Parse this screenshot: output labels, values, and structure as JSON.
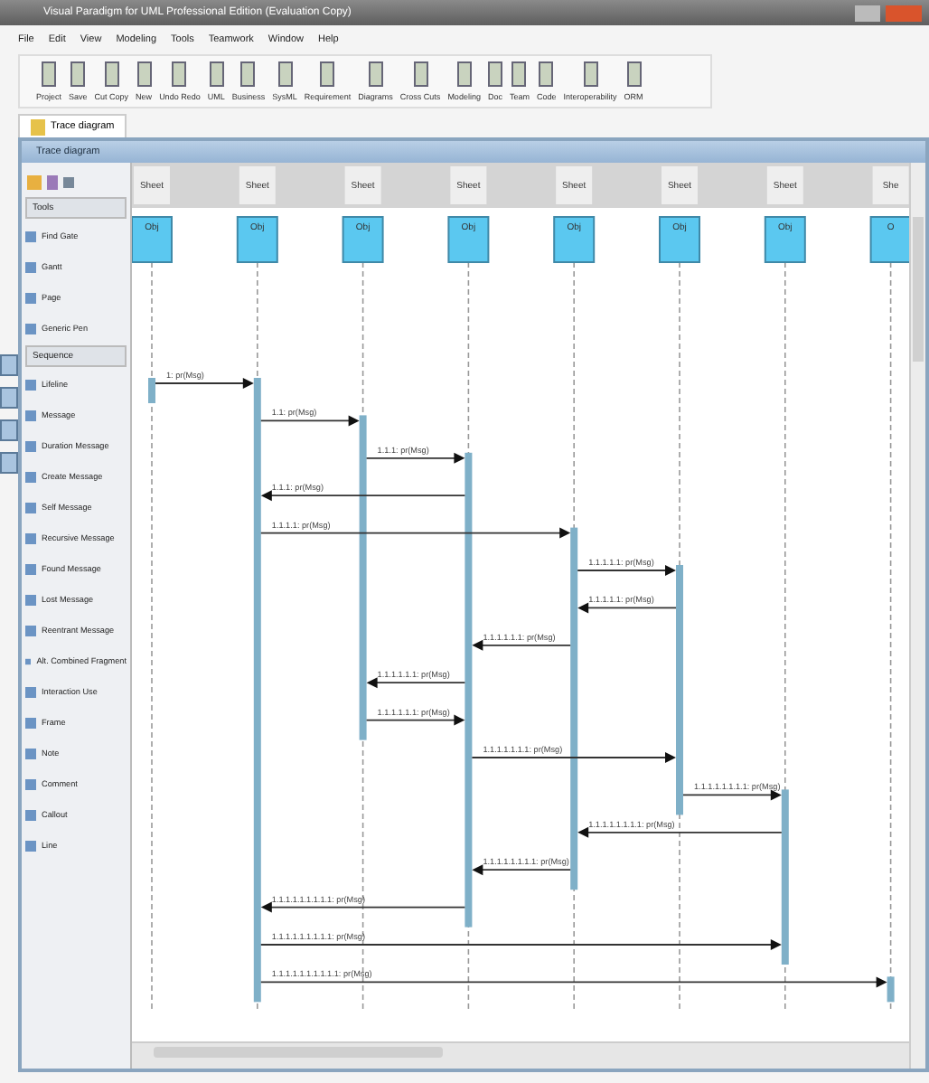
{
  "window": {
    "title": "Visual Paradigm for UML Professional Edition (Evaluation Copy)"
  },
  "menu": [
    "File",
    "Edit",
    "View",
    "Modeling",
    "Tools",
    "Teamwork",
    "Window",
    "Help"
  ],
  "toolbar": [
    "Project",
    "Save",
    "Cut Copy",
    "New",
    "Undo Redo",
    "UML",
    "Business",
    "SysML",
    "Requirement",
    "Diagrams",
    "Cross Cuts",
    "Modeling",
    "Doc",
    "Team",
    "Code",
    "Interoperability",
    "ORM"
  ],
  "tabs": [
    {
      "label": "Trace diagram",
      "selected": true
    }
  ],
  "panel": {
    "title": "Trace diagram"
  },
  "palette": [
    {
      "kind": "section",
      "label": "Tools"
    },
    {
      "kind": "tool",
      "label": "Find Gate"
    },
    {
      "kind": "tool",
      "label": "Gantt"
    },
    {
      "kind": "tool",
      "label": "Page"
    },
    {
      "kind": "tool",
      "label": "Generic Pen"
    },
    {
      "kind": "section",
      "label": "Sequence"
    },
    {
      "kind": "tool",
      "label": "Lifeline"
    },
    {
      "kind": "tool",
      "label": "Message"
    },
    {
      "kind": "tool",
      "label": "Duration Message"
    },
    {
      "kind": "tool",
      "label": "Create Message"
    },
    {
      "kind": "tool",
      "label": "Self Message"
    },
    {
      "kind": "tool",
      "label": "Recursive Message"
    },
    {
      "kind": "tool",
      "label": "Found Message"
    },
    {
      "kind": "tool",
      "label": "Lost Message"
    },
    {
      "kind": "tool",
      "label": "Reentrant Message"
    },
    {
      "kind": "tool",
      "label": "Alt. Combined Fragment"
    },
    {
      "kind": "tool",
      "label": "Interaction Use"
    },
    {
      "kind": "tool",
      "label": "Frame"
    },
    {
      "kind": "tool",
      "label": "Note"
    },
    {
      "kind": "tool",
      "label": "Comment"
    },
    {
      "kind": "tool",
      "label": "Callout"
    },
    {
      "kind": "tool",
      "label": "Line"
    }
  ],
  "diagram": {
    "lifelines": [
      {
        "header": "Sheet",
        "name": "Obj"
      },
      {
        "header": "Sheet",
        "name": "Obj"
      },
      {
        "header": "Sheet",
        "name": "Obj"
      },
      {
        "header": "Sheet",
        "name": "Obj"
      },
      {
        "header": "Sheet",
        "name": "Obj"
      },
      {
        "header": "Sheet",
        "name": "Obj"
      },
      {
        "header": "Sheet",
        "name": "Obj"
      },
      {
        "header": "She",
        "name": "O"
      }
    ],
    "messages": [
      {
        "label": "1: pr(Msg)"
      },
      {
        "label": "1.1: pr(Msg)"
      },
      {
        "label": "1.1.1: pr(Msg)"
      },
      {
        "label": "1.1.1: pr(Msg)"
      },
      {
        "label": "1.1.1.1: pr(Msg)"
      },
      {
        "label": "1.1.1.1.1: pr(Msg)"
      },
      {
        "label": "1.1.1.1.1: pr(Msg)"
      },
      {
        "label": "1.1.1.1.1.1: pr(Msg)"
      },
      {
        "label": "1.1.1.1.1.1: pr(Msg)"
      },
      {
        "label": "1.1.1.1.1.1: pr(Msg)"
      },
      {
        "label": "1.1.1.1.1.1.1: pr(Msg)"
      },
      {
        "label": "1.1.1.1.1.1.1.1: pr(Msg)"
      },
      {
        "label": "1.1.1.1.1.1.1.1: pr(Msg)"
      },
      {
        "label": "1.1.1.1.1.1.1.1: pr(Msg)"
      },
      {
        "label": "1.1.1.1.1.1.1.1.1: pr(Msg)"
      },
      {
        "label": "1.1.1.1.1.1.1.1.1: pr(Msg)"
      },
      {
        "label": "1.1.1.1.1.1.1.1.1.1: pr(Msg)"
      }
    ]
  }
}
